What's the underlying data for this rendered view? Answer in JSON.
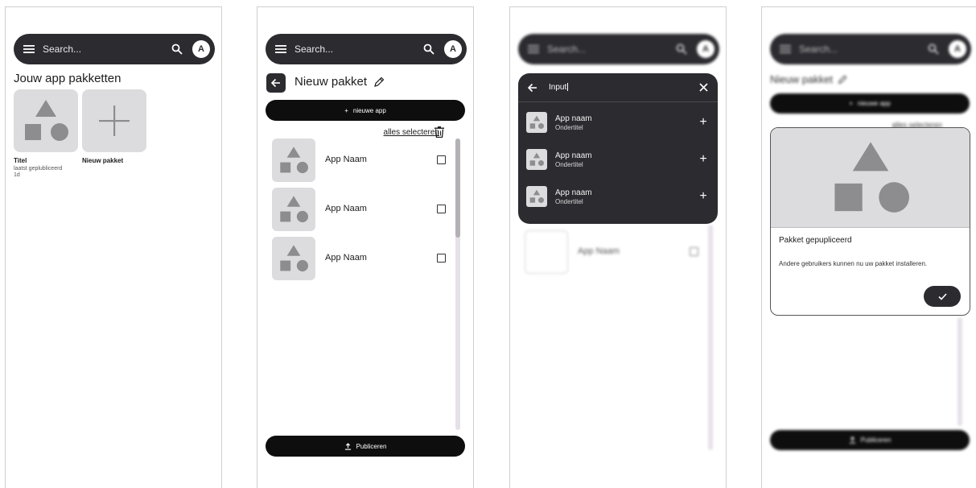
{
  "search": {
    "placeholder": "Search...",
    "avatar_letter": "A"
  },
  "screen1": {
    "title": "Jouw app pakketten",
    "package": {
      "title": "Titel",
      "subtitle": "laatst geplubliceerd",
      "age": "1d"
    },
    "new_package_label": "Nieuw pakket"
  },
  "screen2": {
    "title": "Nieuw pakket",
    "new_app_label": "nieuwe app",
    "select_all": "alles selecteren",
    "apps": [
      {
        "label": "App Naam"
      },
      {
        "label": "App Naam"
      },
      {
        "label": "App Naam"
      }
    ],
    "publish_label": "Publiceren",
    "scroll_fraction": 0.34
  },
  "screen3": {
    "search_input": "Input",
    "results": [
      {
        "title": "App naam",
        "subtitle": "Ondertitel"
      },
      {
        "title": "App naam",
        "subtitle": "Ondertitel"
      },
      {
        "title": "App naam",
        "subtitle": "Ondertitel"
      }
    ],
    "bg_app_label": "App Naam"
  },
  "screen4": {
    "title": "Nieuw pakket",
    "new_app_label": "nieuwe app",
    "select_all": "alles selecteren",
    "dialog_title": "Pakket gepupliceerd",
    "dialog_body": "Andere gebruikers kunnen nu uw pakket installeren.",
    "publish_label": "Publiceren"
  },
  "colors": {
    "dark": "#2c2b30",
    "black_button": "#0e0e0e",
    "placeholder_gray": "#dcdcde",
    "shape_gray": "#8d8c8f"
  },
  "icons": [
    "menu-icon",
    "search-icon",
    "arrow-left-icon",
    "pencil-icon",
    "plus-icon",
    "trash-icon",
    "upload-icon",
    "close-icon",
    "check-icon",
    "shapes-placeholder-icon"
  ]
}
